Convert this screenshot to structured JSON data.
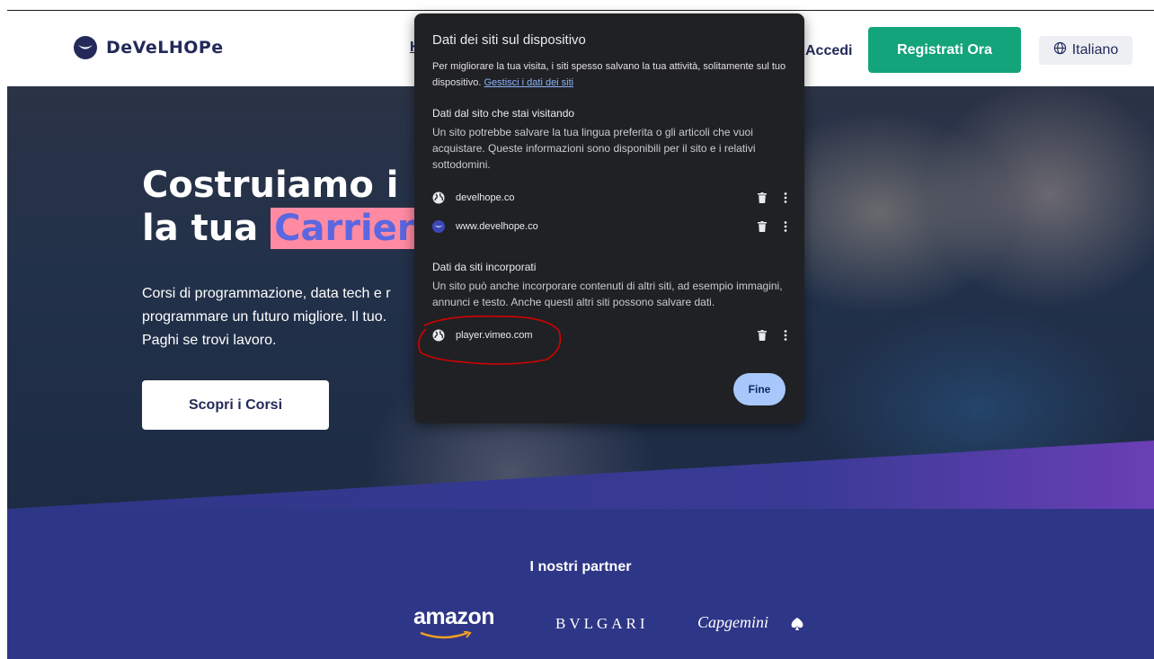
{
  "header": {
    "brand": "DeVeLHOPe",
    "nav_stub": "H",
    "login_label": "Accedi",
    "register_label": "Registrati Ora",
    "language_label": "Italiano"
  },
  "hero": {
    "title_line1": "Costruiamo i",
    "title_line2_prefix": "la tua ",
    "title_line2_highlight": "Carrier",
    "subtitle": "Corsi di programmazione, data tech e r programmare un futuro migliore. Il tuo. Paghi se trovi lavoro.",
    "cta_label": "Scopri i Corsi"
  },
  "partners": {
    "title": "I nostri partner",
    "logos": [
      "amazon",
      "BVLGARI",
      "Capgemini"
    ]
  },
  "popup": {
    "title": "Dati dei siti sul dispositivo",
    "description": "Per migliorare la tua visita, i siti spesso salvano la tua attività, solitamente sul tuo dispositivo. ",
    "manage_link": "Gestisci i dati dei siti",
    "visited_section": {
      "title": "Dati dal sito che stai visitando",
      "description": "Un sito potrebbe salvare la tua lingua preferita o gli articoli che vuoi acquistare. Queste informazioni sono disponibili per il sito e i relativi sottodomini.",
      "sites": [
        "develhope.co",
        "www.develhope.co"
      ]
    },
    "embedded_section": {
      "title": "Dati da siti incorporati",
      "description": "Un sito può anche incorporare contenuti di altri siti, ad esempio immagini, annunci e testo. Anche questi altri siti possono salvare dati.",
      "sites": [
        "player.vimeo.com"
      ]
    },
    "done_label": "Fine"
  },
  "colors": {
    "brand_navy": "#232a5a",
    "register_green": "#13a47c",
    "partners_bg": "#2e3687",
    "highlight_pink": "#ff8aa2",
    "popup_bg": "#202124",
    "link_blue": "#8ab4f8",
    "done_bg": "#a8c7fa",
    "annotation_red": "#d40000"
  },
  "icons": [
    "develhope-logo-icon",
    "globe-icon",
    "trash-icon",
    "more-vert-icon"
  ]
}
